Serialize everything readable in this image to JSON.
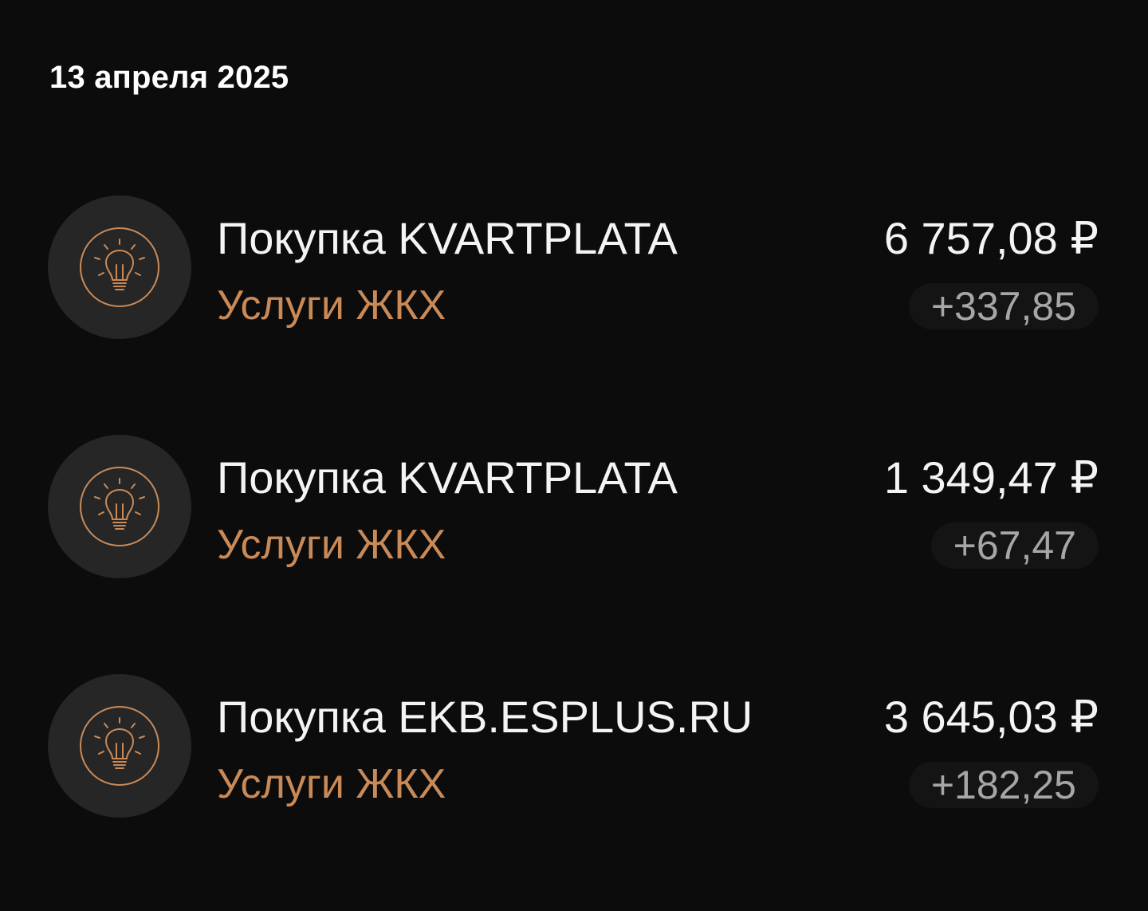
{
  "date": "13 апреля 2025",
  "transactions": [
    {
      "title": "Покупка KVARTPLATA",
      "category": "Услуги ЖКХ",
      "amount": "6 757,08 ₽",
      "bonus": "+337,85",
      "icon": "lightbulb-icon"
    },
    {
      "title": "Покупка KVARTPLATA",
      "category": "Услуги ЖКХ",
      "amount": "1 349,47 ₽",
      "bonus": "+67,47",
      "icon": "lightbulb-icon"
    },
    {
      "title": "Покупка EKB.ESPLUS.RU",
      "category": "Услуги ЖКХ",
      "amount": "3 645,03 ₽",
      "bonus": "+182,25",
      "icon": "lightbulb-icon"
    }
  ],
  "colors": {
    "background": "#0c0c0c",
    "icon_circle": "#262626",
    "accent": "#c98a57",
    "bonus_text": "#a6a6a6",
    "primary_text": "#f4f4f4"
  }
}
